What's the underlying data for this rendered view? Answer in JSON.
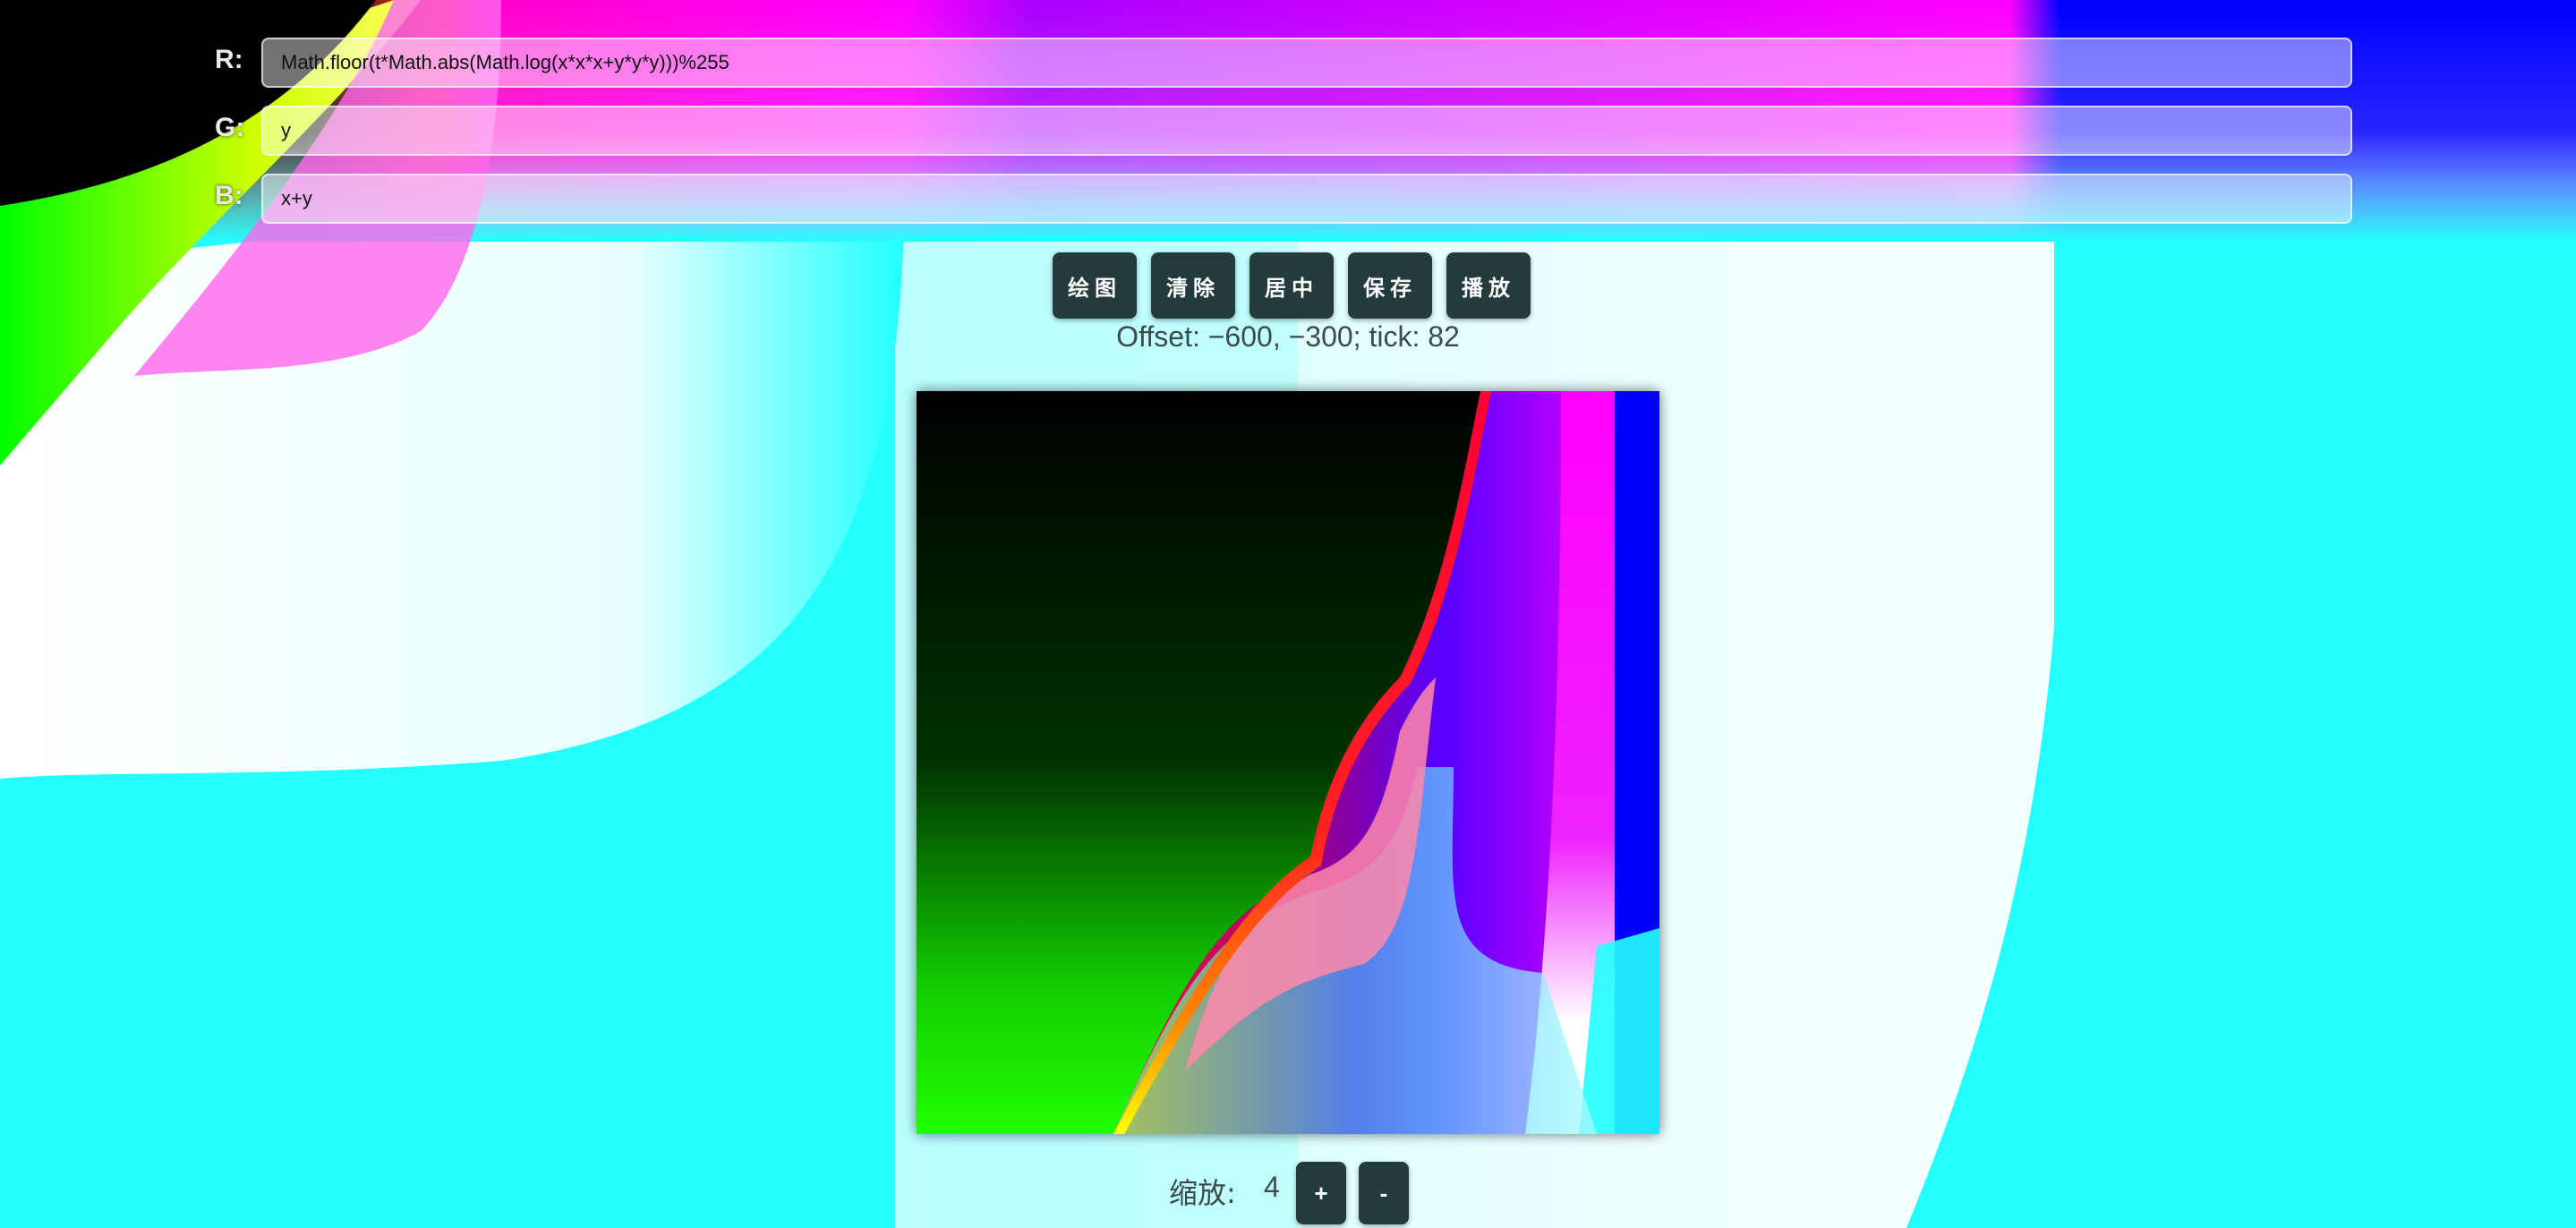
{
  "formulas": {
    "r": {
      "label": "R:",
      "value": "Math.floor(t*Math.abs(Math.log(x*x*x+y*y*y)))%255"
    },
    "g": {
      "label": "G:",
      "value": "y"
    },
    "b": {
      "label": "B:",
      "value": "x+y"
    }
  },
  "toolbar": {
    "draw_label": "绘图",
    "clear_label": "清除",
    "center_label": "居中",
    "save_label": "保存",
    "play_label": "播放"
  },
  "status": "Offset: −600, −300; tick: 82",
  "zoom": {
    "label": "缩放:",
    "value": "4",
    "plus_label": "+",
    "minus_label": "-"
  },
  "colors": {
    "button_bg": "#243b3d",
    "background_cyan": "#22ffff",
    "status_text": "#3c4a4a"
  }
}
